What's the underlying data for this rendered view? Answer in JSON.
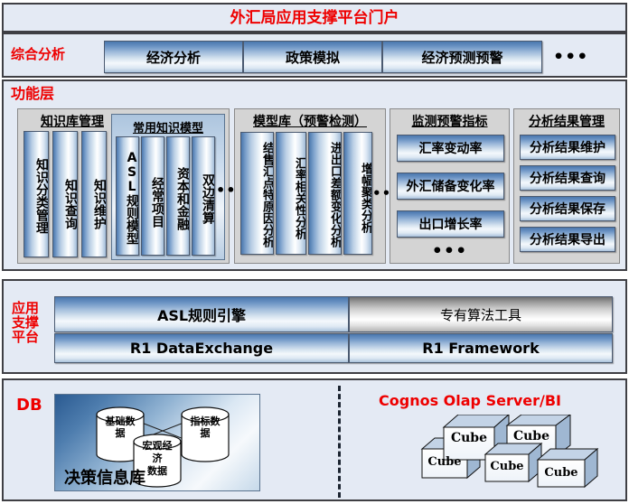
{
  "portal": {
    "title": "外汇局应用支撑平台门户"
  },
  "comprehensive": {
    "label": "综合分析",
    "buttons": [
      "经济分析",
      "政策模拟",
      "经济预测预警"
    ],
    "ellipsis": "•••"
  },
  "function_layer": {
    "label": "功能层",
    "knowledge_base": {
      "title": "知识库管理",
      "items": [
        "知识分类管理",
        "知识查询",
        "知识维护"
      ],
      "models": {
        "title": "常用知识模型",
        "items": [
          "ASL规则模型",
          "经常项目",
          "资本和金融",
          "双边清算"
        ],
        "ellipsis": "••"
      }
    },
    "model_library": {
      "title": "模型库（预警检测）",
      "items": [
        "结售汇点特原因分析",
        "汇率相关性分析",
        "进出口差额变化分析",
        "增幅聚类分析"
      ],
      "ellipsis": "••"
    },
    "monitor_indicators": {
      "title": "监测预警指标",
      "items": [
        "汇率变动率",
        "外汇储备变化率",
        "出口增长率"
      ],
      "ellipsis": "•••"
    },
    "result_management": {
      "title": "分析结果管理",
      "items": [
        "分析结果维护",
        "分析结果查询",
        "分析结果保存",
        "分析结果导出"
      ]
    }
  },
  "support_platform": {
    "label": "应用\n支撑\n平台",
    "label_lines": [
      "应用",
      "支撑",
      "平台"
    ],
    "row1": [
      "ASL规则引擎",
      "专有算法工具"
    ],
    "row2": [
      "R1 DataExchange",
      "R1 Framework"
    ]
  },
  "db_layer": {
    "label": "DB",
    "repository_name": "决策信息库",
    "cylinders": [
      {
        "lines": [
          "基础数",
          "据"
        ]
      },
      {
        "lines": [
          "指标数",
          "据"
        ]
      },
      {
        "lines": [
          "宏观经",
          "济",
          "数据"
        ]
      }
    ],
    "cognos": {
      "title": "Cognos Olap Server/BI",
      "cubes": [
        "Cube",
        "Cube",
        "Cube",
        "Cube",
        "Cube"
      ]
    }
  },
  "colors": {
    "accent_red": "#ee0000",
    "panel_bg": "#e4eaf4",
    "border": "#3f3f44",
    "button_blue": "#4a77ad",
    "group_gray": "#d4d4d4"
  }
}
